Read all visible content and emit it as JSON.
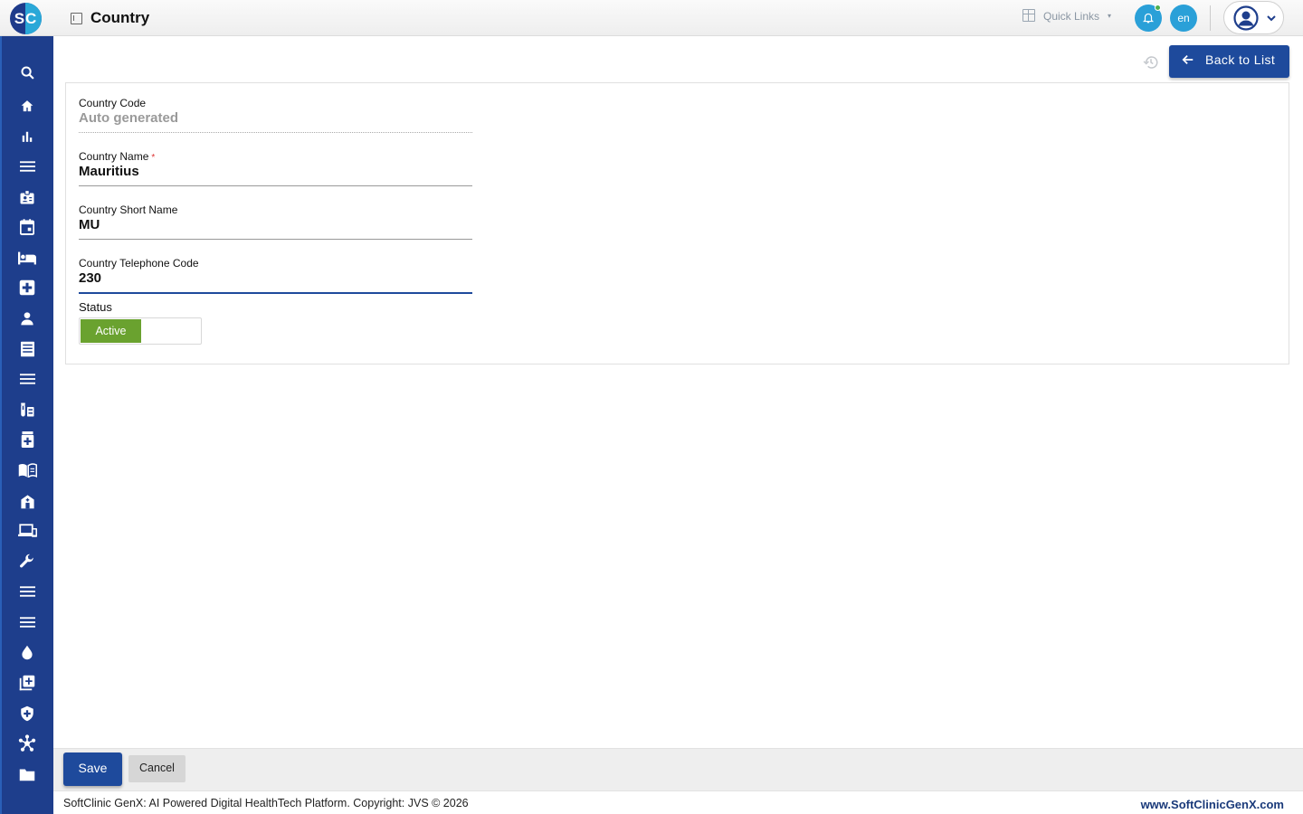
{
  "app": {
    "logo_text": "SC",
    "page_title": "Country"
  },
  "header": {
    "quick_links_label": "Quick Links",
    "language": "en",
    "icons": [
      "page-icon",
      "quick-links-icon",
      "bell-icon",
      "user-avatar-icon",
      "chevron-down-icon"
    ]
  },
  "sidebar": {
    "icons": [
      "search-icon",
      "home-icon",
      "bar-chart-icon",
      "menu-icon",
      "id-badge-icon",
      "calendar-icon",
      "bed-icon",
      "medical-plus-icon",
      "person-icon",
      "document-list-icon",
      "menu-icon",
      "lab-tubes-icon",
      "pharmacy-icon",
      "book-open-icon",
      "hospital-building-icon",
      "devices-icon",
      "wrench-icon",
      "menu-icon",
      "menu-icon",
      "blood-drop-icon",
      "add-library-icon",
      "shield-plus-icon",
      "hub-network-icon",
      "folder-icon"
    ]
  },
  "toolbar": {
    "back_label": "Back to List"
  },
  "form": {
    "country_code": {
      "label": "Country Code",
      "value": "Auto generated"
    },
    "country_name": {
      "label": "Country Name",
      "required_mark": "*",
      "value": "Mauritius"
    },
    "country_short_name": {
      "label": "Country Short Name",
      "value": "MU"
    },
    "country_telephone_code": {
      "label": "Country Telephone Code",
      "value": "230"
    },
    "status": {
      "label": "Status",
      "value": "Active"
    }
  },
  "actions": {
    "save_label": "Save",
    "cancel_label": "Cancel"
  },
  "footer": {
    "copyright": "SoftClinic GenX: AI Powered Digital HealthTech Platform. Copyright: JVS © 2026",
    "website": "www.SoftClinicGenX.com"
  },
  "colors": {
    "primary": "#1e4a9c",
    "sidebar": "#1e3e8c",
    "accent": "#2aa0d8",
    "active_status": "#6aa22f",
    "notification_dot": "#4caf50"
  }
}
